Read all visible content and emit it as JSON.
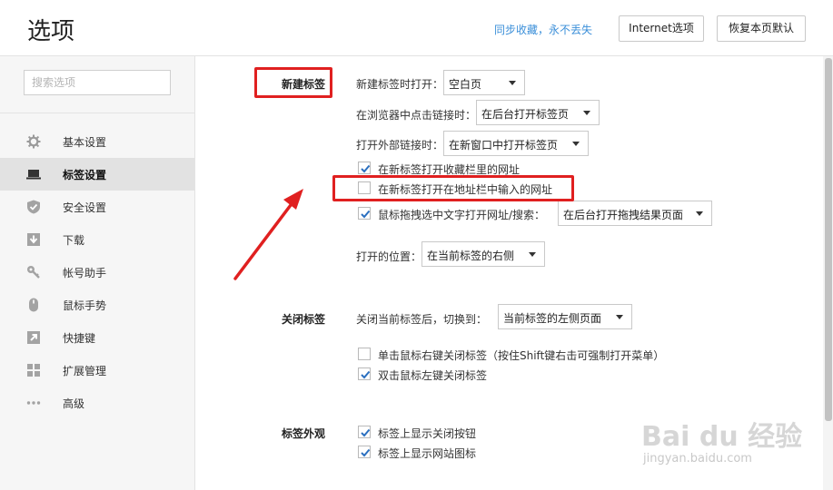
{
  "header": {
    "title": "选项",
    "sync_link": "同步收藏，永不丢失",
    "internet_options_button": "Internet选项",
    "reset_button": "恢复本页默认"
  },
  "sidebar": {
    "search_placeholder": "搜索选项",
    "items": [
      {
        "label": "基本设置",
        "icon": "gear-icon",
        "active": false
      },
      {
        "label": "标签设置",
        "icon": "laptop-icon",
        "active": true
      },
      {
        "label": "安全设置",
        "icon": "shield-icon",
        "active": false
      },
      {
        "label": "下载",
        "icon": "download-icon",
        "active": false
      },
      {
        "label": "帐号助手",
        "icon": "key-icon",
        "active": false
      },
      {
        "label": "鼠标手势",
        "icon": "mouse-icon",
        "active": false
      },
      {
        "label": "快捷键",
        "icon": "shortcut-arrow-icon",
        "active": false
      },
      {
        "label": "扩展管理",
        "icon": "grid-icon",
        "active": false
      },
      {
        "label": "高级",
        "icon": "more-dots-icon",
        "active": false
      }
    ]
  },
  "new_tab": {
    "title": "新建标签",
    "open_label": "新建标签时打开：",
    "open_value": "空白页",
    "click_link_label": "在浏览器中点击链接时：",
    "click_link_value": "在后台打开标签页",
    "external_link_label": "打开外部链接时：",
    "external_link_value": "在新窗口中打开标签页",
    "cb_bookmarks_label": "在新标签打开收藏栏里的网址",
    "cb_bookmarks_checked": true,
    "cb_addressbar_label": "在新标签打开在地址栏中输入的网址",
    "cb_addressbar_checked": false,
    "cb_drag_label": "鼠标拖拽选中文字打开网址/搜索：",
    "cb_drag_checked": true,
    "drag_value": "在后台打开拖拽结果页面",
    "position_label": "打开的位置：",
    "position_value": "在当前标签的右侧"
  },
  "close_tab": {
    "title": "关闭标签",
    "switch_label": "关闭当前标签后，切换到：",
    "switch_value": "当前标签的左侧页面",
    "cb_rightclick_label": "单击鼠标右键关闭标签（按住Shift键右击可强制打开菜单）",
    "cb_rightclick_checked": false,
    "cb_dblclick_label": "双击鼠标左键关闭标签",
    "cb_dblclick_checked": true
  },
  "appearance": {
    "title": "标签外观",
    "cb_close_button_label": "标签上显示关闭按钮",
    "cb_close_button_checked": true,
    "cb_favicon_label": "标签上显示网站图标",
    "cb_favicon_checked": true
  },
  "watermark": {
    "main": "Bai du 经验",
    "sub": "jingyan.baidu.com"
  },
  "colors": {
    "accent_link": "#3b8fd9",
    "checkbox_check": "#2a6fbf",
    "annotation_red": "#e02020",
    "sidebar_bg": "#f6f6f6",
    "sidebar_active_bg": "#e2e2e2"
  }
}
